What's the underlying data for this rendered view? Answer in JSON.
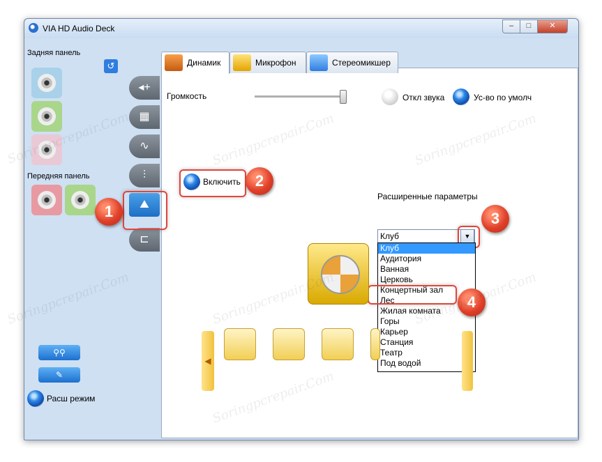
{
  "window": {
    "title": "VIA HD Audio Deck"
  },
  "left_panel": {
    "rear_label": "Задняя панель",
    "front_label": "Передняя панель",
    "adv_mode_label": "Расш режим"
  },
  "tabs": [
    {
      "label": "Динамик",
      "active": true
    },
    {
      "label": "Микрофон",
      "active": false
    },
    {
      "label": "Стереомикшер",
      "active": false
    }
  ],
  "volume": {
    "label": "Громкость",
    "level_fraction": 0.98
  },
  "mute": {
    "label": "Откл звука",
    "selected": false
  },
  "default_device": {
    "label": "Ус-во по умолч",
    "selected": true
  },
  "enable": {
    "label": "Включить",
    "selected": true
  },
  "advanced": {
    "label": "Расширенные параметры",
    "selected_value": "Клуб",
    "options": [
      "Клуб",
      "Аудитория",
      "Ванная",
      "Церковь",
      "Концертный зал",
      "Лес",
      "Жилая комната",
      "Горы",
      "Карьер",
      "Станция",
      "Театр",
      "Под водой"
    ],
    "highlighted_option": "Клуб"
  },
  "callouts": [
    "1",
    "2",
    "3",
    "4"
  ],
  "icons": {
    "app": "app-speaker-icon",
    "restore": "restore-icon",
    "arrow_left": "◀",
    "dropdown": "▼"
  },
  "watermark_text": "Soringpcrepair.Com",
  "colors": {
    "accent": "#3399ff",
    "callout": "#e0402a",
    "highlight_border": "#e0463a"
  }
}
